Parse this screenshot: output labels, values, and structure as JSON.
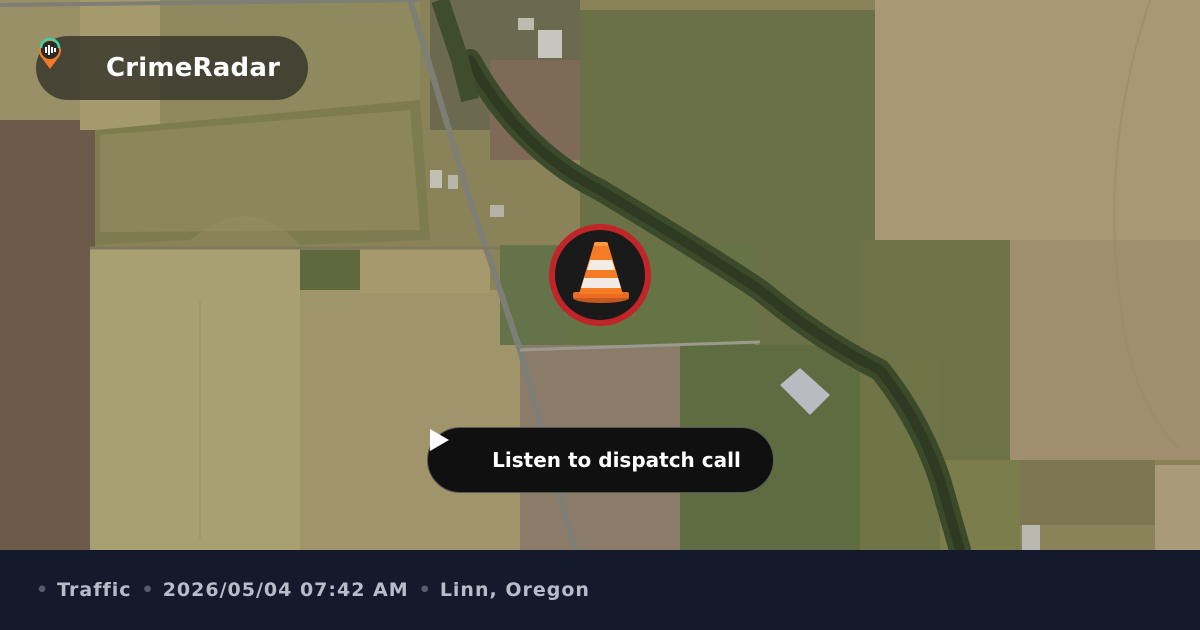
{
  "brand": {
    "name": "CrimeRadar",
    "logo_icon": "location-pin-radio-icon"
  },
  "marker": {
    "icon": "traffic-cone-icon",
    "ring_color": "#c0252a"
  },
  "listen_button": {
    "label": "Listen to dispatch call",
    "icon": "play-icon"
  },
  "footer": {
    "separator": "•",
    "category": "Traffic",
    "datetime": "2026/05/04 07:42 AM",
    "location": "Linn, Oregon"
  },
  "map": {
    "style": "satellite"
  }
}
